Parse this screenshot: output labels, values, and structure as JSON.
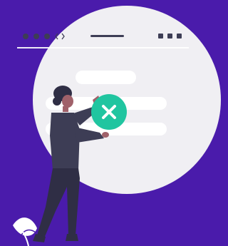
{
  "colors": {
    "background": "#4a1bab",
    "circle": "#f0eff3",
    "browser_chrome": "#ffffff",
    "chrome_dots": "#3d3d55",
    "content_bars": "#ffffff",
    "status_badge": "#20c5a0",
    "badge_icon": "#ffffff",
    "figure_dark": "#2f2e45",
    "skin": "#a0616a",
    "plant": "#ffffff"
  },
  "icons": {
    "nav_arrows": "chevron-left-right-icon",
    "window_controls": "window-controls-icon",
    "status_badge": "close-icon"
  }
}
